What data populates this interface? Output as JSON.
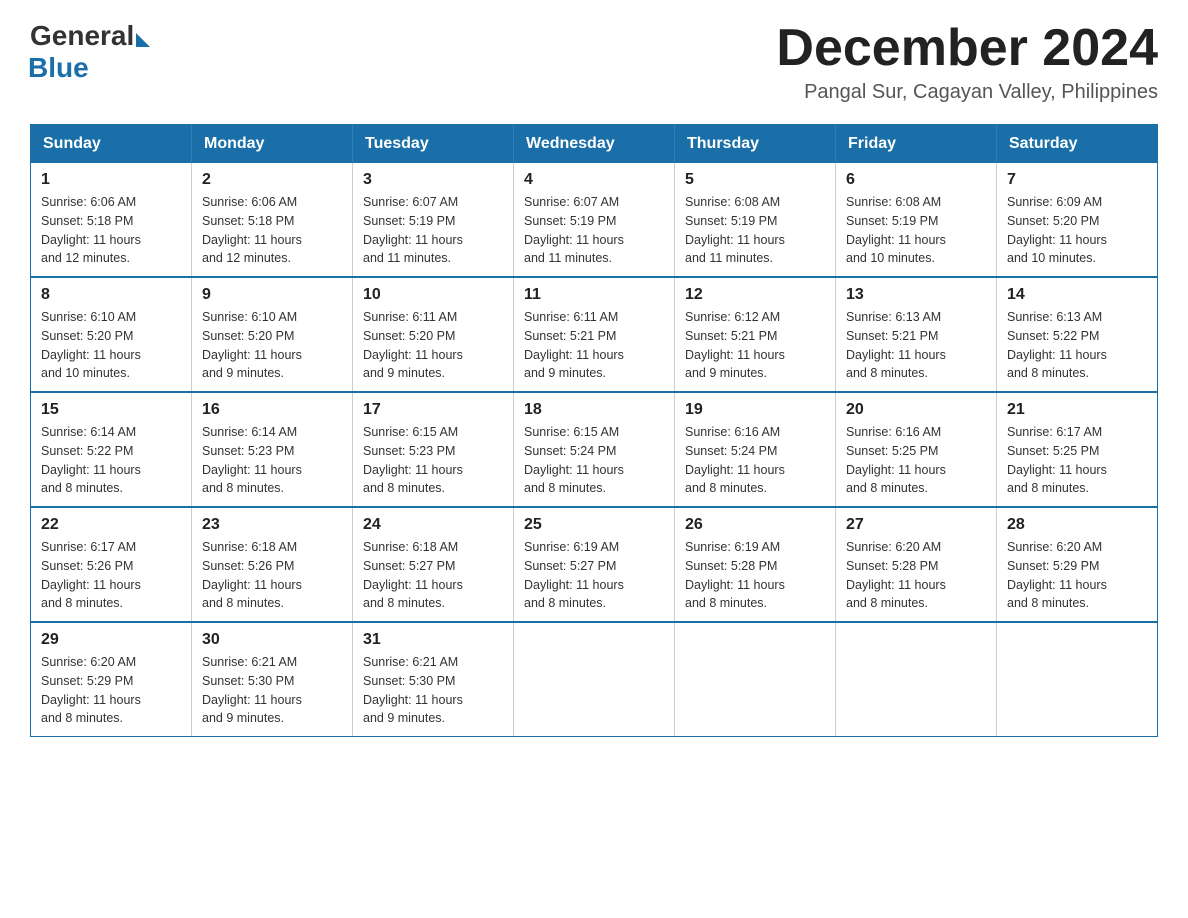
{
  "header": {
    "logo_general": "General",
    "logo_blue": "Blue",
    "month_title": "December 2024",
    "location": "Pangal Sur, Cagayan Valley, Philippines"
  },
  "weekdays": [
    "Sunday",
    "Monday",
    "Tuesday",
    "Wednesday",
    "Thursday",
    "Friday",
    "Saturday"
  ],
  "weeks": [
    [
      {
        "day": "1",
        "sunrise": "6:06 AM",
        "sunset": "5:18 PM",
        "daylight": "11 hours and 12 minutes."
      },
      {
        "day": "2",
        "sunrise": "6:06 AM",
        "sunset": "5:18 PM",
        "daylight": "11 hours and 12 minutes."
      },
      {
        "day": "3",
        "sunrise": "6:07 AM",
        "sunset": "5:19 PM",
        "daylight": "11 hours and 11 minutes."
      },
      {
        "day": "4",
        "sunrise": "6:07 AM",
        "sunset": "5:19 PM",
        "daylight": "11 hours and 11 minutes."
      },
      {
        "day": "5",
        "sunrise": "6:08 AM",
        "sunset": "5:19 PM",
        "daylight": "11 hours and 11 minutes."
      },
      {
        "day": "6",
        "sunrise": "6:08 AM",
        "sunset": "5:19 PM",
        "daylight": "11 hours and 10 minutes."
      },
      {
        "day": "7",
        "sunrise": "6:09 AM",
        "sunset": "5:20 PM",
        "daylight": "11 hours and 10 minutes."
      }
    ],
    [
      {
        "day": "8",
        "sunrise": "6:10 AM",
        "sunset": "5:20 PM",
        "daylight": "11 hours and 10 minutes."
      },
      {
        "day": "9",
        "sunrise": "6:10 AM",
        "sunset": "5:20 PM",
        "daylight": "11 hours and 9 minutes."
      },
      {
        "day": "10",
        "sunrise": "6:11 AM",
        "sunset": "5:20 PM",
        "daylight": "11 hours and 9 minutes."
      },
      {
        "day": "11",
        "sunrise": "6:11 AM",
        "sunset": "5:21 PM",
        "daylight": "11 hours and 9 minutes."
      },
      {
        "day": "12",
        "sunrise": "6:12 AM",
        "sunset": "5:21 PM",
        "daylight": "11 hours and 9 minutes."
      },
      {
        "day": "13",
        "sunrise": "6:13 AM",
        "sunset": "5:21 PM",
        "daylight": "11 hours and 8 minutes."
      },
      {
        "day": "14",
        "sunrise": "6:13 AM",
        "sunset": "5:22 PM",
        "daylight": "11 hours and 8 minutes."
      }
    ],
    [
      {
        "day": "15",
        "sunrise": "6:14 AM",
        "sunset": "5:22 PM",
        "daylight": "11 hours and 8 minutes."
      },
      {
        "day": "16",
        "sunrise": "6:14 AM",
        "sunset": "5:23 PM",
        "daylight": "11 hours and 8 minutes."
      },
      {
        "day": "17",
        "sunrise": "6:15 AM",
        "sunset": "5:23 PM",
        "daylight": "11 hours and 8 minutes."
      },
      {
        "day": "18",
        "sunrise": "6:15 AM",
        "sunset": "5:24 PM",
        "daylight": "11 hours and 8 minutes."
      },
      {
        "day": "19",
        "sunrise": "6:16 AM",
        "sunset": "5:24 PM",
        "daylight": "11 hours and 8 minutes."
      },
      {
        "day": "20",
        "sunrise": "6:16 AM",
        "sunset": "5:25 PM",
        "daylight": "11 hours and 8 minutes."
      },
      {
        "day": "21",
        "sunrise": "6:17 AM",
        "sunset": "5:25 PM",
        "daylight": "11 hours and 8 minutes."
      }
    ],
    [
      {
        "day": "22",
        "sunrise": "6:17 AM",
        "sunset": "5:26 PM",
        "daylight": "11 hours and 8 minutes."
      },
      {
        "day": "23",
        "sunrise": "6:18 AM",
        "sunset": "5:26 PM",
        "daylight": "11 hours and 8 minutes."
      },
      {
        "day": "24",
        "sunrise": "6:18 AM",
        "sunset": "5:27 PM",
        "daylight": "11 hours and 8 minutes."
      },
      {
        "day": "25",
        "sunrise": "6:19 AM",
        "sunset": "5:27 PM",
        "daylight": "11 hours and 8 minutes."
      },
      {
        "day": "26",
        "sunrise": "6:19 AM",
        "sunset": "5:28 PM",
        "daylight": "11 hours and 8 minutes."
      },
      {
        "day": "27",
        "sunrise": "6:20 AM",
        "sunset": "5:28 PM",
        "daylight": "11 hours and 8 minutes."
      },
      {
        "day": "28",
        "sunrise": "6:20 AM",
        "sunset": "5:29 PM",
        "daylight": "11 hours and 8 minutes."
      }
    ],
    [
      {
        "day": "29",
        "sunrise": "6:20 AM",
        "sunset": "5:29 PM",
        "daylight": "11 hours and 8 minutes."
      },
      {
        "day": "30",
        "sunrise": "6:21 AM",
        "sunset": "5:30 PM",
        "daylight": "11 hours and 9 minutes."
      },
      {
        "day": "31",
        "sunrise": "6:21 AM",
        "sunset": "5:30 PM",
        "daylight": "11 hours and 9 minutes."
      },
      null,
      null,
      null,
      null
    ]
  ],
  "labels": {
    "sunrise": "Sunrise:",
    "sunset": "Sunset:",
    "daylight": "Daylight:"
  }
}
